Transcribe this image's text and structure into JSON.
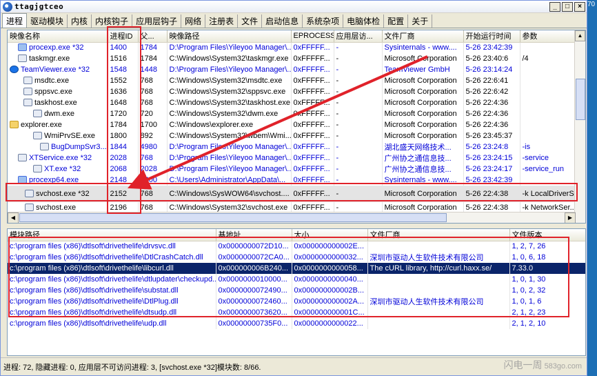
{
  "window": {
    "title": "ttagjgtceo"
  },
  "tabs": [
    "进程",
    "驱动模块",
    "内核",
    "内核钩子",
    "应用层钩子",
    "网络",
    "注册表",
    "文件",
    "启动信息",
    "系统杂项",
    "电脑体检",
    "配置",
    "关于"
  ],
  "process_table": {
    "columns": [
      "映像名称",
      "进程ID",
      "父...",
      "映像路径",
      "EPROCESS",
      "应用层访...",
      "文件厂商",
      "开始运行时间",
      "参数"
    ],
    "rows": [
      {
        "icon": "tool-icon",
        "name": "procexp.exe *32",
        "pid": "1400",
        "ppid": "1784",
        "path": "D:\\Program Files\\Yileyoo Manager\\...",
        "eprocess": "0xFFFFF...",
        "access": "-",
        "vendor": "Sysinternals - www....",
        "start": "5-26 23:42:39",
        "args": "",
        "style": "blue"
      },
      {
        "icon": "pe-icon",
        "name": "taskmgr.exe",
        "pid": "1516",
        "ppid": "1784",
        "path": "C:\\Windows\\System32\\taskmgr.exe",
        "eprocess": "0xFFFFF...",
        "access": "-",
        "vendor": "Microsoft Corporation",
        "start": "5-26 23:40:6",
        "args": "/4",
        "style": "black"
      },
      {
        "icon": "teamviewer-icon",
        "name": "TeamViewer.exe *32",
        "pid": "1548",
        "ppid": "1448",
        "path": "D:\\Program Files\\Yileyoo Manager\\...",
        "eprocess": "0xFFFFF...",
        "access": "-",
        "vendor": "TeamViewer GmbH",
        "start": "5-26 23:14:24",
        "args": "",
        "style": "blue"
      },
      {
        "icon": "pe-icon",
        "name": "msdtc.exe",
        "pid": "1552",
        "ppid": "768",
        "path": "C:\\Windows\\System32\\msdtc.exe",
        "eprocess": "0xFFFFF...",
        "access": "-",
        "vendor": "Microsoft Corporation",
        "start": "5-26 22:6:41",
        "args": "",
        "style": "black"
      },
      {
        "icon": "pe-icon",
        "name": "sppsvc.exe",
        "pid": "1636",
        "ppid": "768",
        "path": "C:\\Windows\\System32\\sppsvc.exe",
        "eprocess": "0xFFFFF...",
        "access": "-",
        "vendor": "Microsoft Corporation",
        "start": "5-26 22:6:42",
        "args": "",
        "style": "black"
      },
      {
        "icon": "pe-icon",
        "name": "taskhost.exe",
        "pid": "1648",
        "ppid": "768",
        "path": "C:\\Windows\\System32\\taskhost.exe",
        "eprocess": "0xFFFFF...",
        "access": "-",
        "vendor": "Microsoft Corporation",
        "start": "5-26 22:4:36",
        "args": "",
        "style": "black"
      },
      {
        "icon": "pe-icon",
        "name": "dwm.exe",
        "pid": "1720",
        "ppid": "720",
        "path": "C:\\Windows\\System32\\dwm.exe",
        "eprocess": "0xFFFFF...",
        "access": "-",
        "vendor": "Microsoft Corporation",
        "start": "5-26 22:4:36",
        "args": "",
        "style": "black"
      },
      {
        "icon": "folder-icon",
        "name": "explorer.exe",
        "pid": "1784",
        "ppid": "1700",
        "path": "C:\\Windows\\explorer.exe",
        "eprocess": "0xFFFFF...",
        "access": "-",
        "vendor": "Microsoft Corporation",
        "start": "5-26 22:4:36",
        "args": "",
        "style": "black"
      },
      {
        "icon": "pe-icon",
        "name": "WmiPrvSE.exe",
        "pid": "1800",
        "ppid": "892",
        "path": "C:\\Windows\\System32\\wbem\\Wmi...",
        "eprocess": "0xFFFFF...",
        "access": "-",
        "vendor": "Microsoft Corporation",
        "start": "5-26 23:45:37",
        "args": "",
        "style": "black"
      },
      {
        "icon": "pe-icon",
        "name": "BugDumpSvr3...",
        "pid": "1844",
        "ppid": "4980",
        "path": "D:\\Program Files\\Yileyoo Manager\\...",
        "eprocess": "0xFFFFF...",
        "access": "-",
        "vendor": "湖北盛天网络技术...",
        "start": "5-26 23:24:8",
        "args": "-is",
        "style": "blue"
      },
      {
        "icon": "pe-icon",
        "name": "XTService.exe *32",
        "pid": "2028",
        "ppid": "768",
        "path": "D:\\Program Files\\Yileyoo Manager\\...",
        "eprocess": "0xFFFFF...",
        "access": "-",
        "vendor": "广州协之通信息技...",
        "start": "5-26 23:24:15",
        "args": "-service",
        "style": "blue"
      },
      {
        "icon": "pe-icon",
        "name": "XT.exe *32",
        "pid": "2068",
        "ppid": "2028",
        "path": "D:\\Program Files\\Yileyoo Manager\\...",
        "eprocess": "0xFFFFF...",
        "access": "-",
        "vendor": "广州协之通信息技...",
        "start": "5-26 23:24:17",
        "args": "-service_run",
        "style": "blue"
      },
      {
        "icon": "tool-icon",
        "name": "procexp64.exe",
        "pid": "2148",
        "ppid": "1400",
        "path": "C:\\Users\\Administrator\\AppData\\...",
        "eprocess": "0xFFFFF...",
        "access": "-",
        "vendor": "Sysinternals - www....",
        "start": "5-26 23:42:39",
        "args": "",
        "style": "blue"
      },
      {
        "icon": "pe-icon",
        "name": "svchost.exe *32",
        "pid": "2152",
        "ppid": "768",
        "path": "C:\\Windows\\SysWOW64\\svchost....",
        "eprocess": "0xFFFFF...",
        "access": "-",
        "vendor": "Microsoft Corporation",
        "start": "5-26 22:4:38",
        "args": "-k LocalDriverS...",
        "style": "hl"
      },
      {
        "icon": "pe-icon",
        "name": "svchost.exe",
        "pid": "2196",
        "ppid": "768",
        "path": "C:\\Windows\\System32\\svchost.exe",
        "eprocess": "0xFFFFF...",
        "access": "-",
        "vendor": "Microsoft Corporation",
        "start": "5-26 22:4:38",
        "args": "-k NetworkSer...",
        "style": "black"
      }
    ]
  },
  "module_table": {
    "columns": [
      "模块路径",
      "基地址",
      "大小",
      "文件厂商",
      "文件版本"
    ],
    "rows": [
      {
        "path": "c:\\program files (x86)\\dtlsoft\\drivethelife\\drvsvc.dll",
        "base": "0x0000000072D10...",
        "size": "0x000000000002E...",
        "vendor": "",
        "version": "1, 2, 7, 26",
        "style": "blue"
      },
      {
        "path": "c:\\program files (x86)\\dtlsoft\\drivethelife\\DtlCrashCatch.dll",
        "base": "0x0000000072CA0...",
        "size": "0x0000000000032...",
        "vendor": "深圳市驱动人生软件技术有限公司",
        "version": "1, 0, 6, 18",
        "style": "blue"
      },
      {
        "path": "c:\\program files (x86)\\dtlsoft\\drivethelife\\libcurl.dll",
        "base": "0x000000006B240...",
        "size": "0x0000000000058...",
        "vendor": "The cURL library, http://curl.haxx.se/",
        "version": "7.33.0",
        "style": "sel"
      },
      {
        "path": "c:\\program files (x86)\\dtlsoft\\drivethelife\\dtlupdater\\checkupd...",
        "base": "0x0000000010000...",
        "size": "0x0000000000040...",
        "vendor": "",
        "version": "1, 0, 1, 30",
        "style": "blue"
      },
      {
        "path": "c:\\program files (x86)\\dtlsoft\\drivethelife\\substat.dll",
        "base": "0x0000000072490...",
        "size": "0x000000000002B...",
        "vendor": "",
        "version": "1, 0, 2, 32",
        "style": "blue"
      },
      {
        "path": "c:\\program files (x86)\\dtlsoft\\drivethelife\\DtlPlug.dll",
        "base": "0x0000000072460...",
        "size": "0x000000000002A...",
        "vendor": "深圳市驱动人生软件技术有限公司",
        "version": "1, 0, 1, 6",
        "style": "blue"
      },
      {
        "path": "c:\\program files (x86)\\dtlsoft\\drivethelife\\dtsudp.dll",
        "base": "0x0000000073620...",
        "size": "0x000000000001C...",
        "vendor": "",
        "version": "2, 1, 2, 23",
        "style": "blue"
      },
      {
        "path": "c:\\program files (x86)\\dtlsoft\\drivethelife\\udp.dll",
        "base": "0x00000000735F0...",
        "size": "0x0000000000022...",
        "vendor": "",
        "version": "2, 1, 2, 10",
        "style": "blue"
      }
    ]
  },
  "status_bar": {
    "text": "进程: 72, 隐藏进程: 0, 应用层不可访问进程: 3, [svchost.exe *32]模块数: 8/66."
  },
  "watermark": {
    "brand": "583go.com",
    "label": "闪电一周"
  },
  "side_text": "70",
  "colors": {
    "accent_blue": "#0000d8",
    "selection": "#0a246a",
    "annotation_red": "#e0222a"
  }
}
